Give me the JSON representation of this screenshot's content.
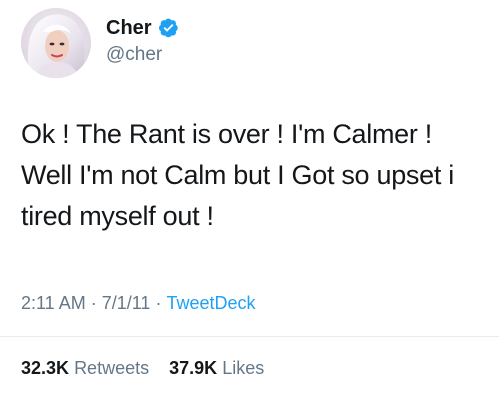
{
  "user": {
    "display_name": "Cher",
    "handle": "@cher",
    "verified_icon": "verified-badge-icon",
    "avatar": "profile-avatar"
  },
  "tweet": {
    "text": "Ok ! The Rant is over ! I'm Calmer !\nWell I'm not Calm but I Got so upset i\ntired myself out !",
    "time": "2:11 AM",
    "date": "7/1/11",
    "separator": "·",
    "source": "TweetDeck"
  },
  "stats": {
    "retweets_count": "32.3K",
    "retweets_label": "Retweets",
    "likes_count": "37.9K",
    "likes_label": "Likes"
  },
  "colors": {
    "text": "#14171a",
    "secondary": "#657786",
    "link": "#1da1f2",
    "verified": "#1da1f2",
    "divider": "#e6ecf0"
  }
}
